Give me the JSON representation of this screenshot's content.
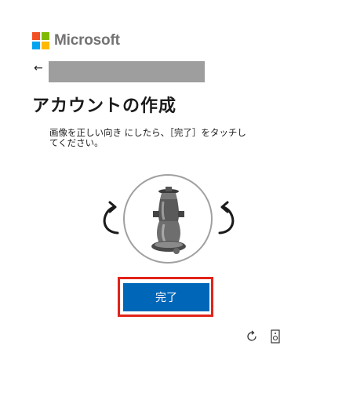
{
  "brand": {
    "name": "Microsoft"
  },
  "colors": {
    "accent_blue": "#0067b8",
    "highlight_red": "#e2231a",
    "redacted_gray": "#9e9e9e",
    "logo_red": "#f25022",
    "logo_green": "#7fba00",
    "logo_blue": "#00a4ef",
    "logo_yellow": "#ffb900"
  },
  "header": {
    "back_icon": "back-arrow-icon",
    "title": "アカウントの作成"
  },
  "puzzle": {
    "instruction": "画像を正しい向き にしたら、［完了］をタッチしてください。",
    "rotate_left_icon": "rotate-left-icon",
    "rotate_right_icon": "rotate-right-icon"
  },
  "actions": {
    "done_label": "完了"
  },
  "tools": {
    "refresh_icon": "refresh-icon",
    "audio_icon": "audio-icon"
  }
}
